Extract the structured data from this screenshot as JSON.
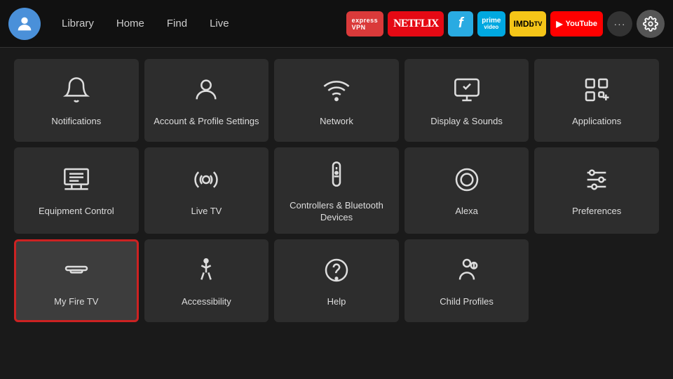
{
  "topbar": {
    "nav": [
      {
        "label": "Library",
        "id": "library"
      },
      {
        "label": "Home",
        "id": "home"
      },
      {
        "label": "Find",
        "id": "find"
      },
      {
        "label": "Live",
        "id": "live"
      }
    ],
    "apps": [
      {
        "id": "expressvpn",
        "label": "ExpressVPN",
        "class": "app-expressvpn"
      },
      {
        "id": "netflix",
        "label": "NETFLIX",
        "class": "app-netflix"
      },
      {
        "id": "freevee",
        "label": "F",
        "class": "app-freevee"
      },
      {
        "id": "prime",
        "label": "prime\nvideo",
        "class": "app-prime"
      },
      {
        "id": "imdb",
        "label": "IMDbTV",
        "class": "app-imdb"
      },
      {
        "id": "youtube",
        "label": "▶ YouTube",
        "class": "app-youtube"
      }
    ],
    "more_label": "···",
    "settings_icon": "⚙"
  },
  "settings": {
    "tiles": [
      {
        "id": "notifications",
        "label": "Notifications",
        "icon": "bell"
      },
      {
        "id": "account",
        "label": "Account & Profile Settings",
        "icon": "person"
      },
      {
        "id": "network",
        "label": "Network",
        "icon": "wifi"
      },
      {
        "id": "display-sounds",
        "label": "Display & Sounds",
        "icon": "display"
      },
      {
        "id": "applications",
        "label": "Applications",
        "icon": "apps"
      },
      {
        "id": "equipment-control",
        "label": "Equipment Control",
        "icon": "monitor"
      },
      {
        "id": "live-tv",
        "label": "Live TV",
        "icon": "antenna"
      },
      {
        "id": "controllers-bluetooth",
        "label": "Controllers & Bluetooth Devices",
        "icon": "remote"
      },
      {
        "id": "alexa",
        "label": "Alexa",
        "icon": "alexa"
      },
      {
        "id": "preferences",
        "label": "Preferences",
        "icon": "sliders"
      },
      {
        "id": "my-fire-tv",
        "label": "My Fire TV",
        "icon": "firetv",
        "focused": true
      },
      {
        "id": "accessibility",
        "label": "Accessibility",
        "icon": "accessibility"
      },
      {
        "id": "help",
        "label": "Help",
        "icon": "help"
      },
      {
        "id": "child-profiles",
        "label": "Child Profiles",
        "icon": "child"
      }
    ]
  }
}
